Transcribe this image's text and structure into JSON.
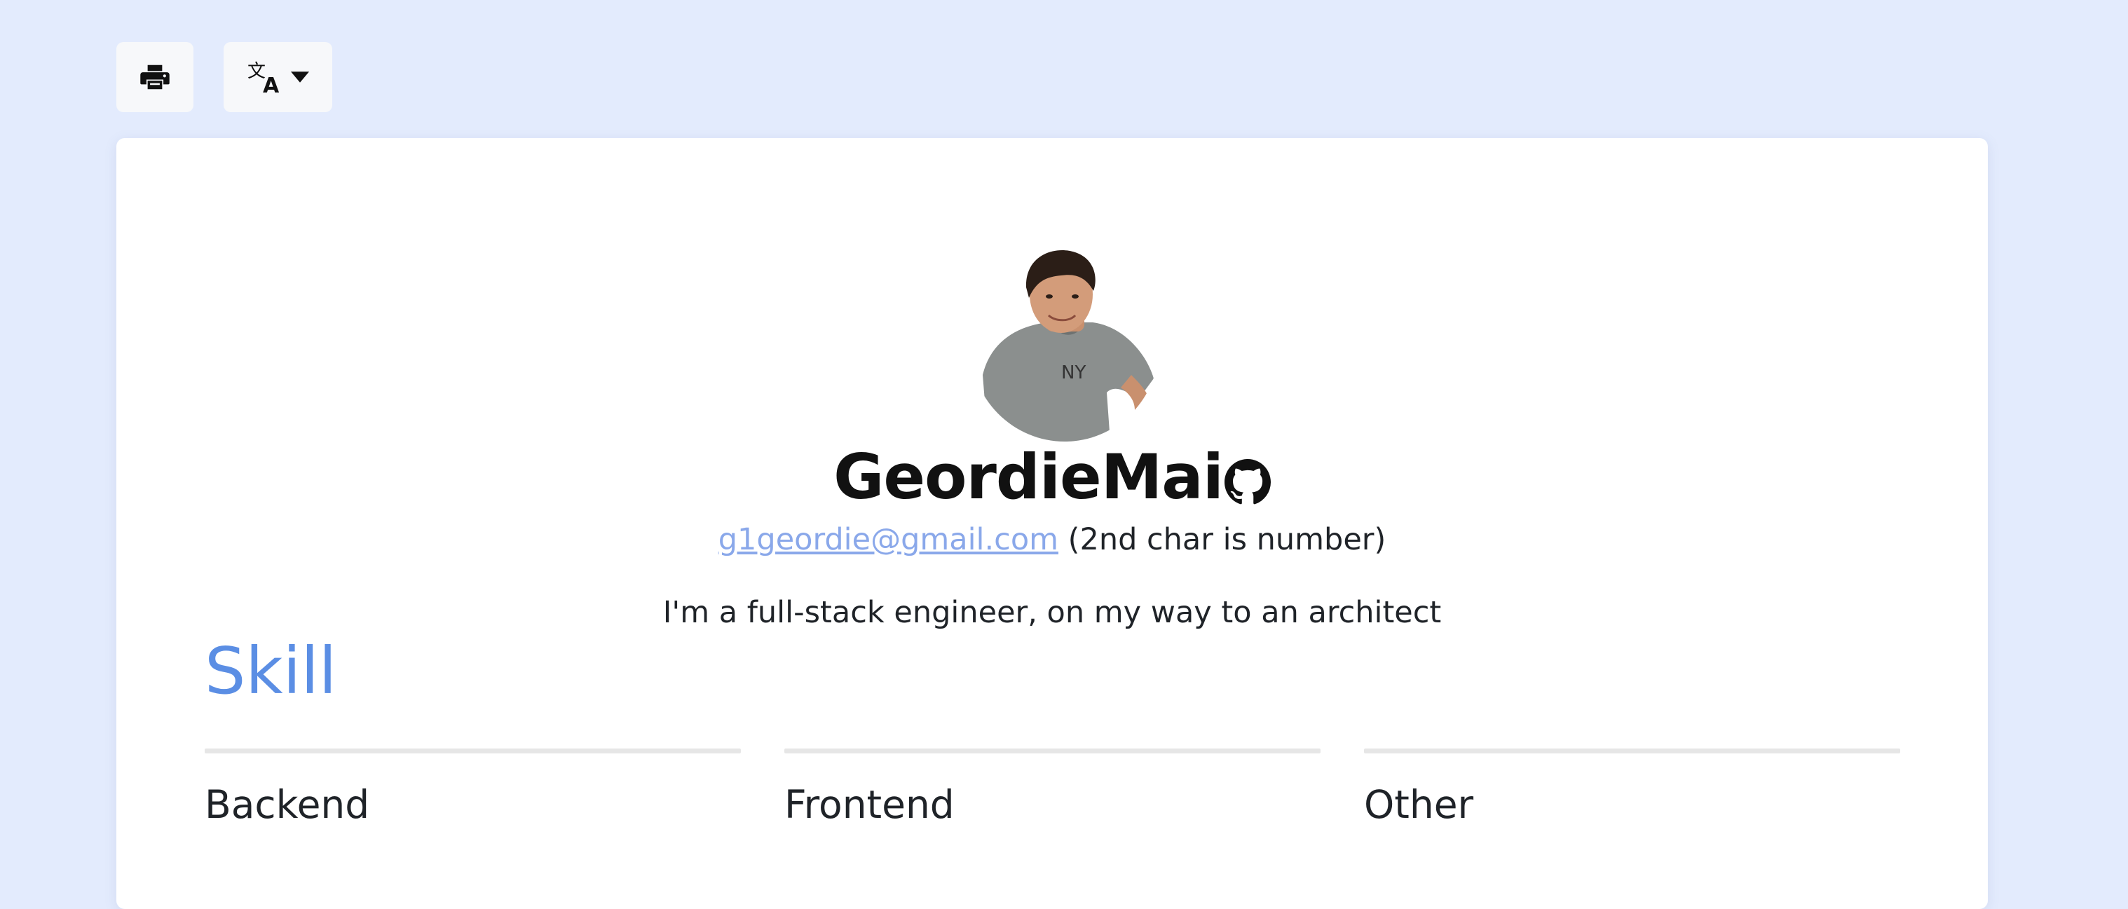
{
  "toolbar": {
    "print_icon": "printer-icon",
    "lang_icon": "translate-icon",
    "lang_caret_icon": "caret-down-icon"
  },
  "profile": {
    "name": "GeordieMai",
    "github_icon": "github-icon",
    "email": "g1geordie@gmail.com",
    "email_note": " (2nd char is number)",
    "tagline": "I'm a full-stack engineer, on my way to an architect"
  },
  "skill": {
    "title": "Skill",
    "columns": [
      {
        "title": "Backend"
      },
      {
        "title": "Frontend"
      },
      {
        "title": "Other"
      }
    ]
  },
  "colors": {
    "page_bg": "#e3ebfd",
    "accent": "#5b8ee4",
    "link": "#8aa8ea"
  }
}
